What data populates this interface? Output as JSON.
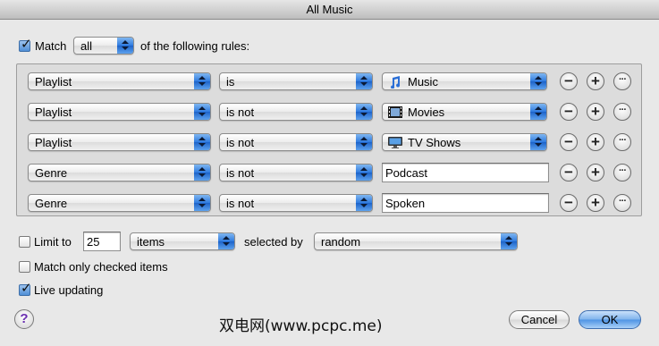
{
  "window": {
    "title": "All Music"
  },
  "match": {
    "checkbox_label": "Match",
    "mode_value": "all",
    "suffix": "of the following rules:",
    "checked": true
  },
  "rules": [
    {
      "field": "Playlist",
      "operator": "is",
      "value": "Music",
      "value_icon": "music-note-icon",
      "value_type": "popup"
    },
    {
      "field": "Playlist",
      "operator": "is not",
      "value": "Movies",
      "value_icon": "film-icon",
      "value_type": "popup"
    },
    {
      "field": "Playlist",
      "operator": "is not",
      "value": "TV Shows",
      "value_icon": "tv-icon",
      "value_type": "popup"
    },
    {
      "field": "Genre",
      "operator": "is not",
      "value": "Podcast",
      "value_type": "text"
    },
    {
      "field": "Genre",
      "operator": "is not",
      "value": "Spoken",
      "value_type": "text"
    }
  ],
  "rule_buttons": {
    "remove": "−",
    "add": "+",
    "more": "···"
  },
  "limit": {
    "label": "Limit to",
    "count": "25",
    "unit": "items",
    "selected_by_label": "selected by",
    "selected_by_value": "random",
    "checked": false
  },
  "match_checked": {
    "label": "Match only checked items",
    "checked": false
  },
  "live_updating": {
    "label": "Live updating",
    "checked": true
  },
  "buttons": {
    "help": "?",
    "cancel": "Cancel",
    "ok": "OK"
  },
  "watermark": "双电网(www.pcpc.me)"
}
